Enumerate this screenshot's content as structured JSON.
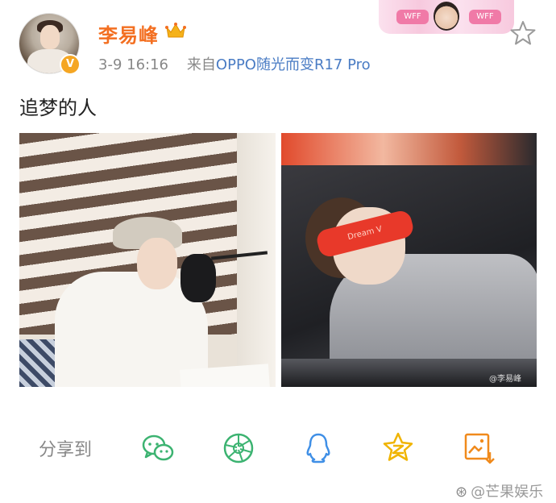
{
  "post": {
    "username": "李易峰",
    "time": "3-9 16:16",
    "source_prefix": "来自",
    "source": "OPPO随光而变R17 Pro",
    "text": "追梦的人"
  },
  "photos": {
    "right_watermark": "@李易峰",
    "mask_text": "Dream V"
  },
  "decor": {
    "tag_left": "WFF",
    "tag_right": "WFF"
  },
  "share": {
    "label": "分享到",
    "targets": [
      "wechat-icon",
      "moments-icon",
      "qq-icon",
      "qzone-icon",
      "save-image-icon"
    ]
  },
  "watermark": {
    "text": "@芒果娱乐"
  },
  "colors": {
    "username": "#f36f21",
    "source": "#4a7cc4",
    "share_green": "#3cb371",
    "share_blue": "#3f8fe6",
    "share_gold": "#f0b400",
    "share_orange": "#f08a1c"
  }
}
